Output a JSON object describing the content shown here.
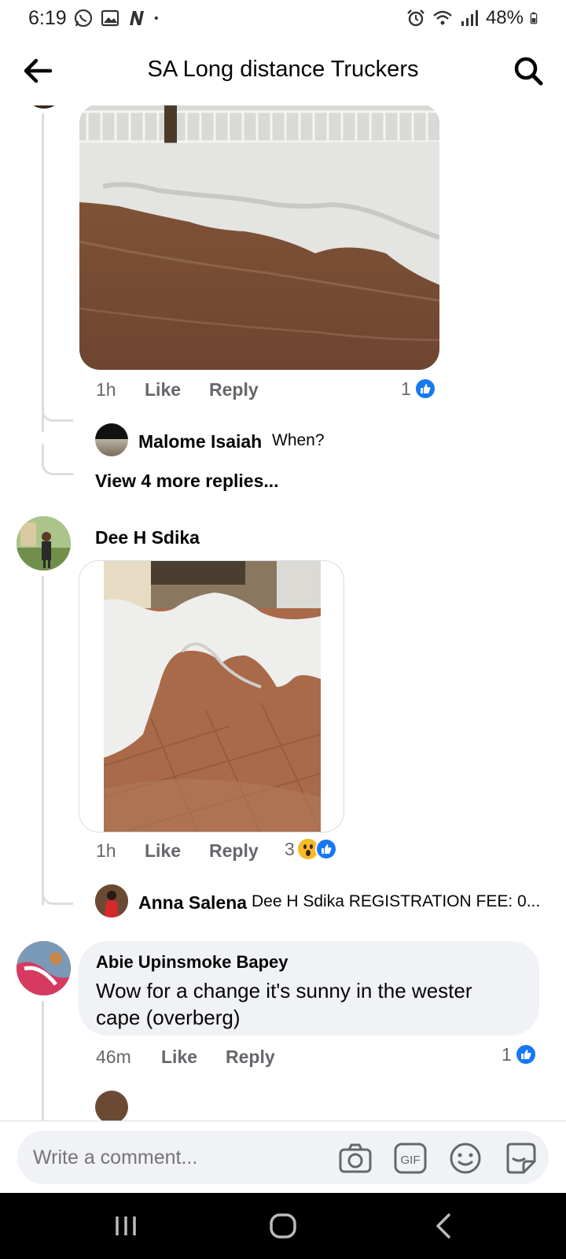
{
  "status_bar": {
    "time": "6:19",
    "battery": "48%",
    "left_icons": [
      "whatsapp-icon",
      "gallery-icon",
      "n-app-icon",
      "dot-icon"
    ],
    "right_icons": [
      "alarm-icon",
      "wifi-icon",
      "signal-icon",
      "battery-icon"
    ]
  },
  "header": {
    "title": "SA Long distance Truckers",
    "back_icon": "arrow-left-icon",
    "search_icon": "search-icon"
  },
  "thread": {
    "first_comment": {
      "time": "1h",
      "like_label": "Like",
      "reply_label": "Reply",
      "reaction_count": "1"
    },
    "reply_1": {
      "name": "Malome Isaiah",
      "text": "When?"
    },
    "view_more": "View 4 more replies...",
    "second_comment": {
      "name": "Dee H Sdika",
      "time": "1h",
      "like_label": "Like",
      "reply_label": "Reply",
      "reaction_count": "3"
    },
    "reply_2": {
      "name": "Anna Salena",
      "text": "Dee H Sdika REGISTRATION FEE: 0..."
    },
    "third_comment": {
      "name": "Abie Upinsmoke Bapey",
      "text": "Wow for a change it's sunny in the wester cape (overberg)",
      "time": "46m",
      "like_label": "Like",
      "reply_label": "Reply",
      "reaction_count": "1"
    }
  },
  "composer": {
    "placeholder": "Write a comment...",
    "icons": [
      "camera-icon",
      "gif-icon",
      "emoji-icon",
      "sticker-icon"
    ]
  },
  "nav_bar": {
    "icons": [
      "recent-apps-icon",
      "home-icon",
      "back-nav-icon"
    ]
  },
  "colors": {
    "like_blue": "#1877f2",
    "bubble_gray": "#f0f2f5",
    "meta_gray": "#65676b",
    "thread_line": "#dadde1"
  }
}
